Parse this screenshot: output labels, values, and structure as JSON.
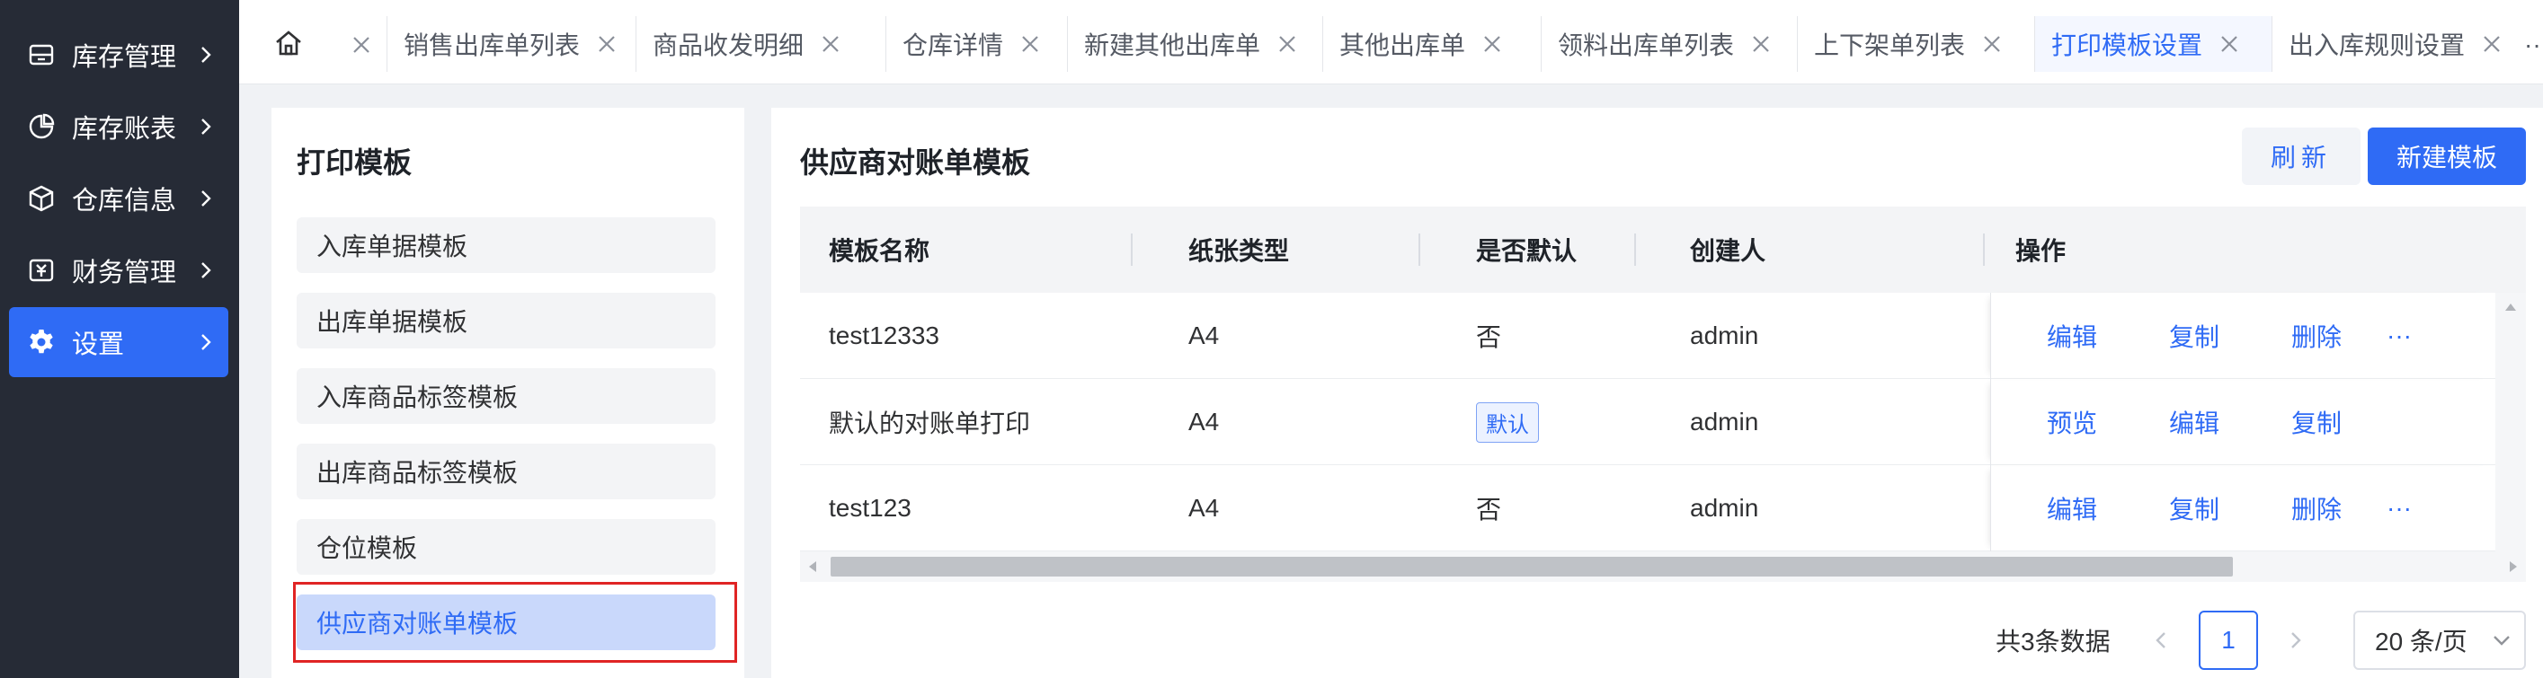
{
  "colors": {
    "sidebar_bg": "#262b36",
    "accent": "#2f6bf5",
    "highlight_border": "#e02424"
  },
  "sidebar": {
    "items": [
      {
        "label": "库存管理",
        "icon": "building-icon"
      },
      {
        "label": "库存账表",
        "icon": "pie-chart-icon"
      },
      {
        "label": "仓库信息",
        "icon": "box-icon"
      },
      {
        "label": "财务管理",
        "icon": "finance-icon"
      },
      {
        "label": "设置",
        "icon": "gear-icon",
        "active": true
      }
    ]
  },
  "tabs": {
    "home_icon": "home-icon",
    "items": [
      {
        "label": "销售出库单列表"
      },
      {
        "label": "商品收发明细"
      },
      {
        "label": "仓库详情"
      },
      {
        "label": "新建其他出库单"
      },
      {
        "label": "其他出库单"
      },
      {
        "label": "领料出库单列表"
      },
      {
        "label": "上下架单列表"
      },
      {
        "label": "打印模板设置",
        "active": true
      },
      {
        "label": "出入库规则设置"
      }
    ],
    "more": "···"
  },
  "left_panel": {
    "title": "打印模板",
    "items": [
      {
        "label": "入库单据模板"
      },
      {
        "label": "出库单据模板"
      },
      {
        "label": "入库商品标签模板"
      },
      {
        "label": "出库商品标签模板"
      },
      {
        "label": "仓位模板"
      },
      {
        "label": "供应商对账单模板",
        "active": true
      }
    ]
  },
  "main": {
    "title": "供应商对账单模板",
    "refresh_label": "刷新",
    "new_label": "新建模板",
    "table": {
      "columns": [
        "模板名称",
        "纸张类型",
        "是否默认",
        "创建人",
        "操作"
      ],
      "rows": [
        {
          "name": "test12333",
          "paper": "A4",
          "default": "否",
          "default_badge": false,
          "creator": "admin",
          "ops": [
            "编辑",
            "复制",
            "删除"
          ],
          "more": "···"
        },
        {
          "name": "默认的对账单打印",
          "paper": "A4",
          "default": "默认",
          "default_badge": true,
          "creator": "admin",
          "ops": [
            "预览",
            "编辑",
            "复制"
          ],
          "more": ""
        },
        {
          "name": "test123",
          "paper": "A4",
          "default": "否",
          "default_badge": false,
          "creator": "admin",
          "ops": [
            "编辑",
            "复制",
            "删除"
          ],
          "more": "···"
        }
      ]
    },
    "pagination": {
      "total_text": "共3条数据",
      "current_page": "1",
      "page_size": "20 条/页"
    }
  }
}
